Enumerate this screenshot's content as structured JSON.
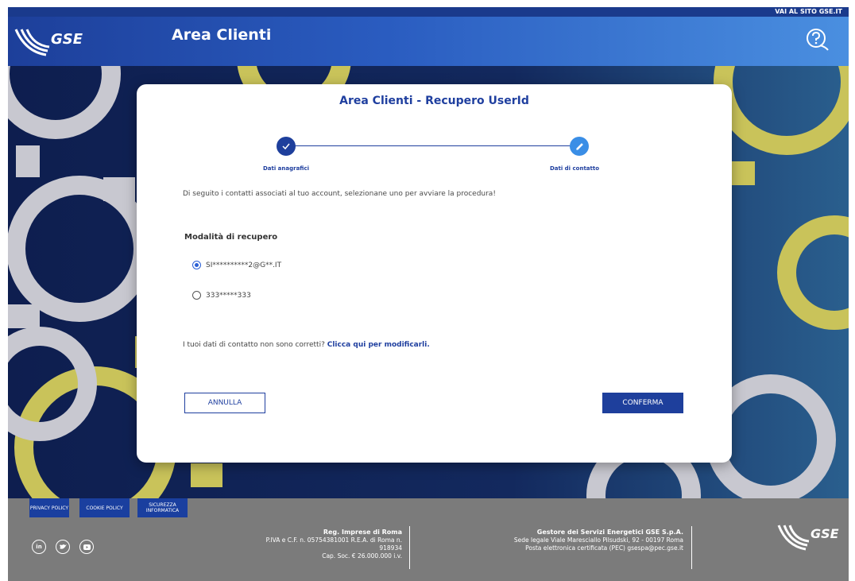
{
  "topbar": {
    "link": "VAI AL SITO GSE.IT"
  },
  "header": {
    "logo_text": "GSE",
    "title": "Area Clienti"
  },
  "card": {
    "title": "Area Clienti - Recupero UserId",
    "steps": [
      {
        "label": "Dati anagrafici",
        "state": "completed",
        "icon": "check-icon"
      },
      {
        "label": "Dati di contatto",
        "state": "active",
        "icon": "pencil-icon"
      }
    ],
    "info": "Di seguito i contatti associati al tuo account, selezionane uno per avviare la procedura!",
    "section_title": "Modalità di recupero",
    "options": [
      {
        "label": "SI**********2@G**.IT",
        "selected": true
      },
      {
        "label": "333*****333",
        "selected": false
      }
    ],
    "notice_text": "I tuoi dati di contatto non sono corretti?",
    "notice_link": "Clicca qui per modificarli.",
    "cancel_label": "ANNULLA",
    "confirm_label": "CONFERMA"
  },
  "footer": {
    "buttons": [
      "PRIVACY POLICY",
      "COOKIE POLICY",
      "SICUREZZA INFORMATICA"
    ],
    "social": [
      "in",
      "twitter",
      "youtube"
    ],
    "reg_title": "Reg. Imprese di Roma",
    "reg_line1": "P.IVA e C.F. n. 05754381001 R.E.A. di Roma n.",
    "reg_line2": "918934",
    "reg_line3": "Cap. Soc. € 26.000.000 i.v.",
    "company_title": "Gestore dei Servizi Energetici GSE S.p.A.",
    "company_line1": "Sede legale Viale Maresciallo Pilsudski, 92 - 00197 Roma",
    "company_line2": "Posta elettronica certificata (PEC) gsespa@pec.gse.it",
    "logo_text": "GSE"
  },
  "colors": {
    "primary": "#1e3f9c",
    "accent": "#3a8ee6",
    "gear_yellow": "#c9c35a",
    "gear_grey": "#c8c8d0"
  }
}
